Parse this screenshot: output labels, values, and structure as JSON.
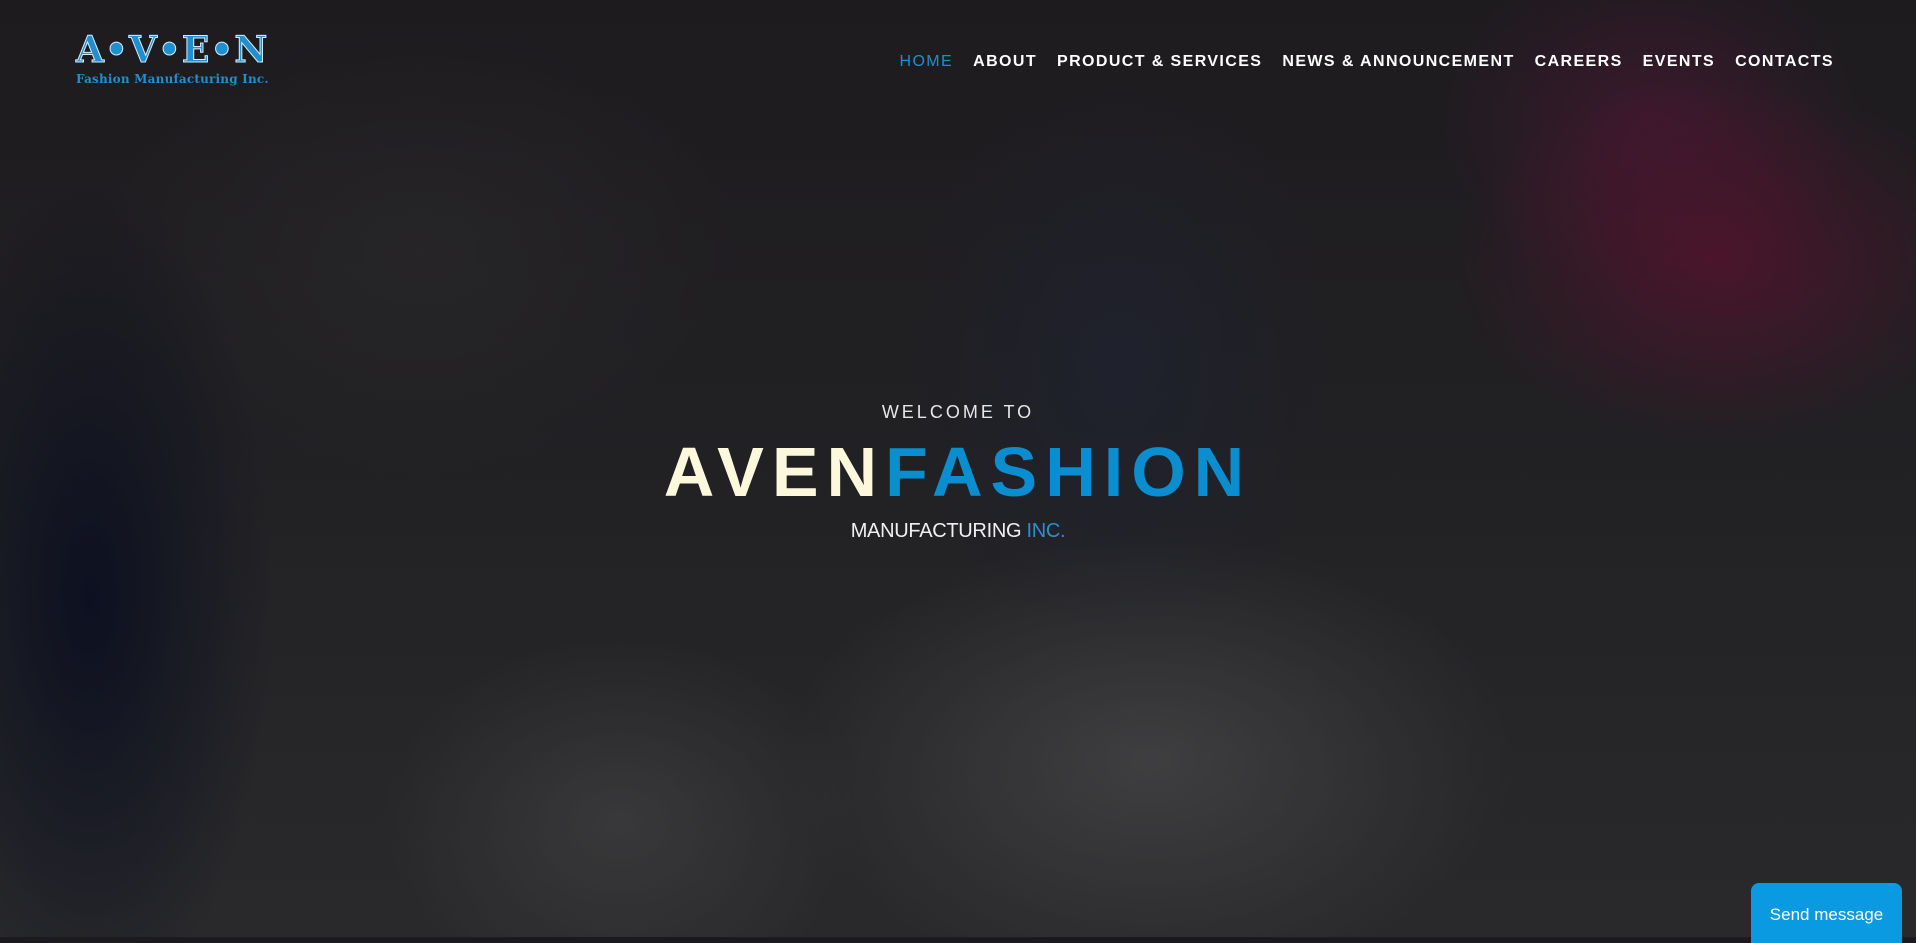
{
  "brand": {
    "logo_main": "A•V•E•N",
    "logo_sub": "Fashion Manufacturing Inc."
  },
  "nav": {
    "items": [
      {
        "label": "HOME",
        "active": true
      },
      {
        "label": "ABOUT"
      },
      {
        "label": "PRODUCT & SERVICES"
      },
      {
        "label": "NEWS & ANNOUNCEMENT"
      },
      {
        "label": "CAREERS"
      },
      {
        "label": "EVENTS"
      },
      {
        "label": "CONTACTS"
      }
    ]
  },
  "hero": {
    "welcome": "WELCOME TO",
    "title_part1": "AVEN",
    "title_part2": "FASHION",
    "subtitle_part1": "MANUFACTURING",
    "subtitle_part2": " INC."
  },
  "chat": {
    "label": "Send message"
  },
  "colors": {
    "accent": "#0a8ed0",
    "title_light": "#fdf8dc",
    "chat_button": "#0a9ae1"
  }
}
